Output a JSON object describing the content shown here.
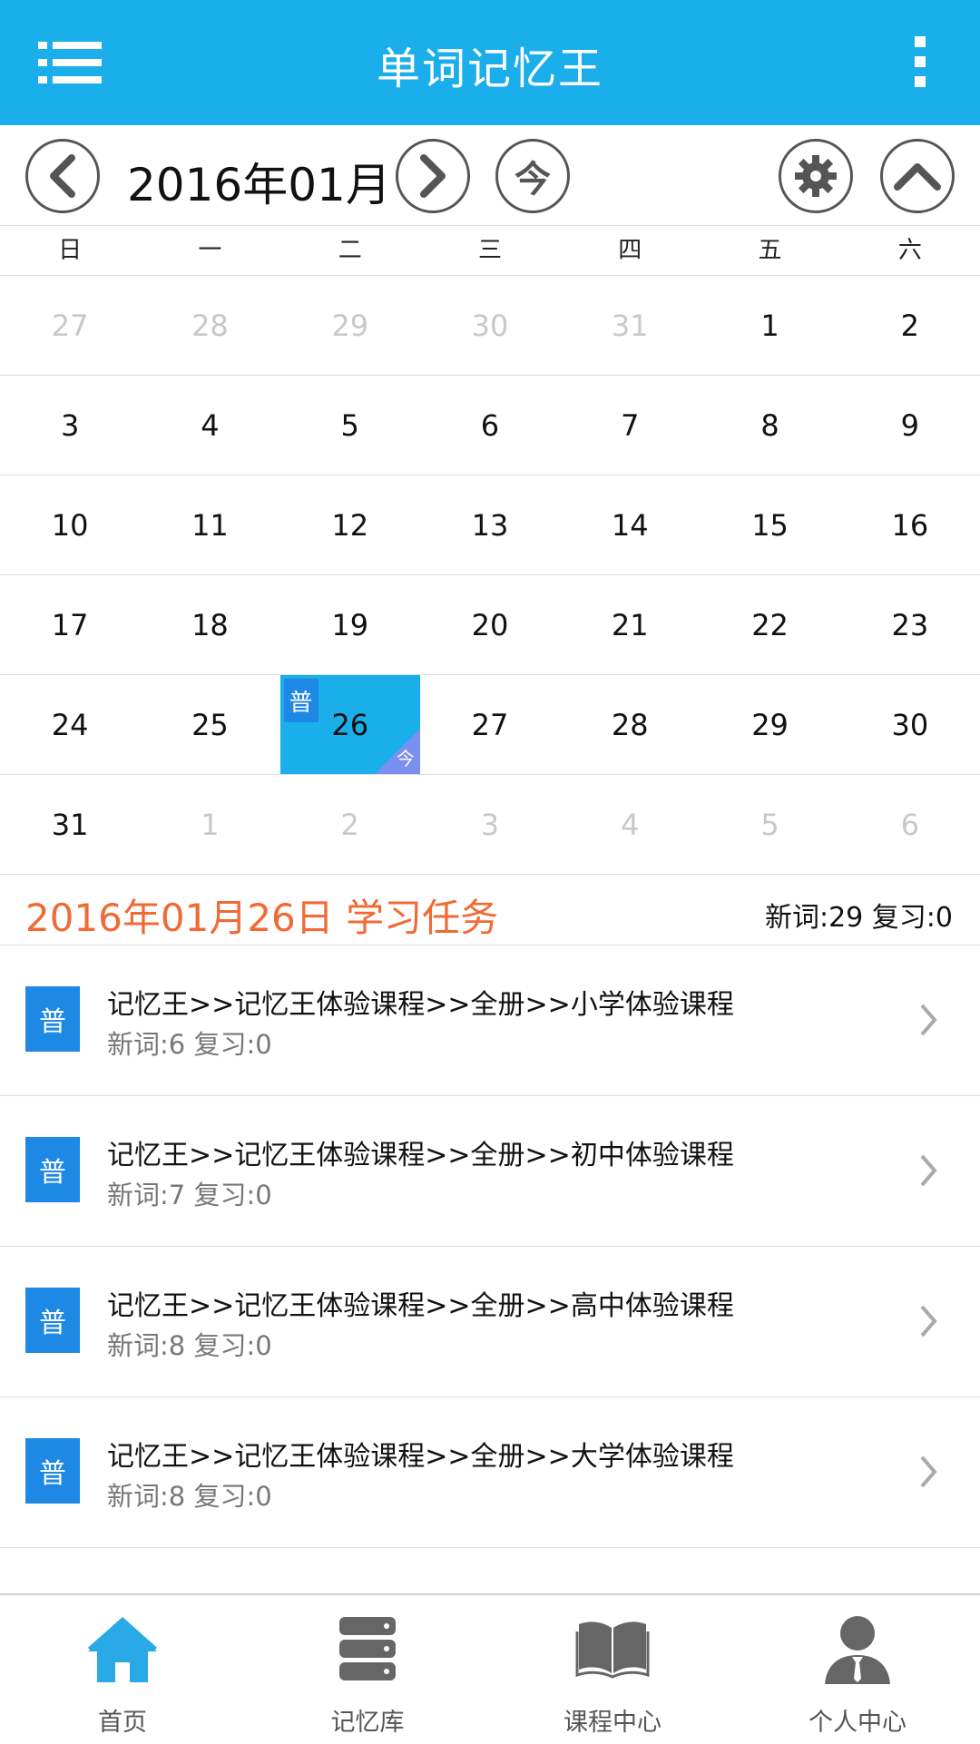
{
  "app": {
    "title": "单词记忆王"
  },
  "calendar": {
    "month_label": "2016年01月",
    "today_button": "今",
    "weekdays": [
      "日",
      "一",
      "二",
      "三",
      "四",
      "五",
      "六"
    ],
    "weeks": [
      [
        {
          "d": "27",
          "other": true
        },
        {
          "d": "28",
          "other": true
        },
        {
          "d": "29",
          "other": true
        },
        {
          "d": "30",
          "other": true
        },
        {
          "d": "31",
          "other": true
        },
        {
          "d": "1"
        },
        {
          "d": "2"
        }
      ],
      [
        {
          "d": "3"
        },
        {
          "d": "4"
        },
        {
          "d": "5"
        },
        {
          "d": "6"
        },
        {
          "d": "7"
        },
        {
          "d": "8"
        },
        {
          "d": "9"
        }
      ],
      [
        {
          "d": "10"
        },
        {
          "d": "11"
        },
        {
          "d": "12"
        },
        {
          "d": "13"
        },
        {
          "d": "14"
        },
        {
          "d": "15"
        },
        {
          "d": "16"
        }
      ],
      [
        {
          "d": "17"
        },
        {
          "d": "18"
        },
        {
          "d": "19"
        },
        {
          "d": "20"
        },
        {
          "d": "21"
        },
        {
          "d": "22"
        },
        {
          "d": "23"
        }
      ],
      [
        {
          "d": "24"
        },
        {
          "d": "25"
        },
        {
          "d": "26",
          "selected": true,
          "badge": "普",
          "today": "今"
        },
        {
          "d": "27"
        },
        {
          "d": "28"
        },
        {
          "d": "29"
        },
        {
          "d": "30"
        }
      ],
      [
        {
          "d": "31"
        },
        {
          "d": "1",
          "other": true
        },
        {
          "d": "2",
          "other": true
        },
        {
          "d": "3",
          "other": true
        },
        {
          "d": "4",
          "other": true
        },
        {
          "d": "5",
          "other": true
        },
        {
          "d": "6",
          "other": true
        }
      ]
    ]
  },
  "tasks_header": {
    "date_title": "2016年01月26日 学习任务",
    "counts": "新词:29 复习:0"
  },
  "tasks": [
    {
      "badge": "普",
      "path": "记忆王>>记忆王体验课程>>全册>>小学体验课程",
      "stats": "新词:6 复习:0"
    },
    {
      "badge": "普",
      "path": "记忆王>>记忆王体验课程>>全册>>初中体验课程",
      "stats": "新词:7 复习:0"
    },
    {
      "badge": "普",
      "path": "记忆王>>记忆王体验课程>>全册>>高中体验课程",
      "stats": "新词:8 复习:0"
    },
    {
      "badge": "普",
      "path": "记忆王>>记忆王体验课程>>全册>>大学体验课程",
      "stats": "新词:8 复习:0"
    }
  ],
  "bottom_nav": [
    {
      "label": "首页",
      "icon": "home-icon",
      "active": true
    },
    {
      "label": "记忆库",
      "icon": "database-icon"
    },
    {
      "label": "课程中心",
      "icon": "book-icon"
    },
    {
      "label": "个人中心",
      "icon": "person-icon"
    }
  ],
  "colors": {
    "primary": "#1aaeea",
    "accent_orange": "#f06a35",
    "badge_blue": "#1e88e5",
    "home_active": "#29a9e6",
    "icon_gray": "#666666"
  }
}
